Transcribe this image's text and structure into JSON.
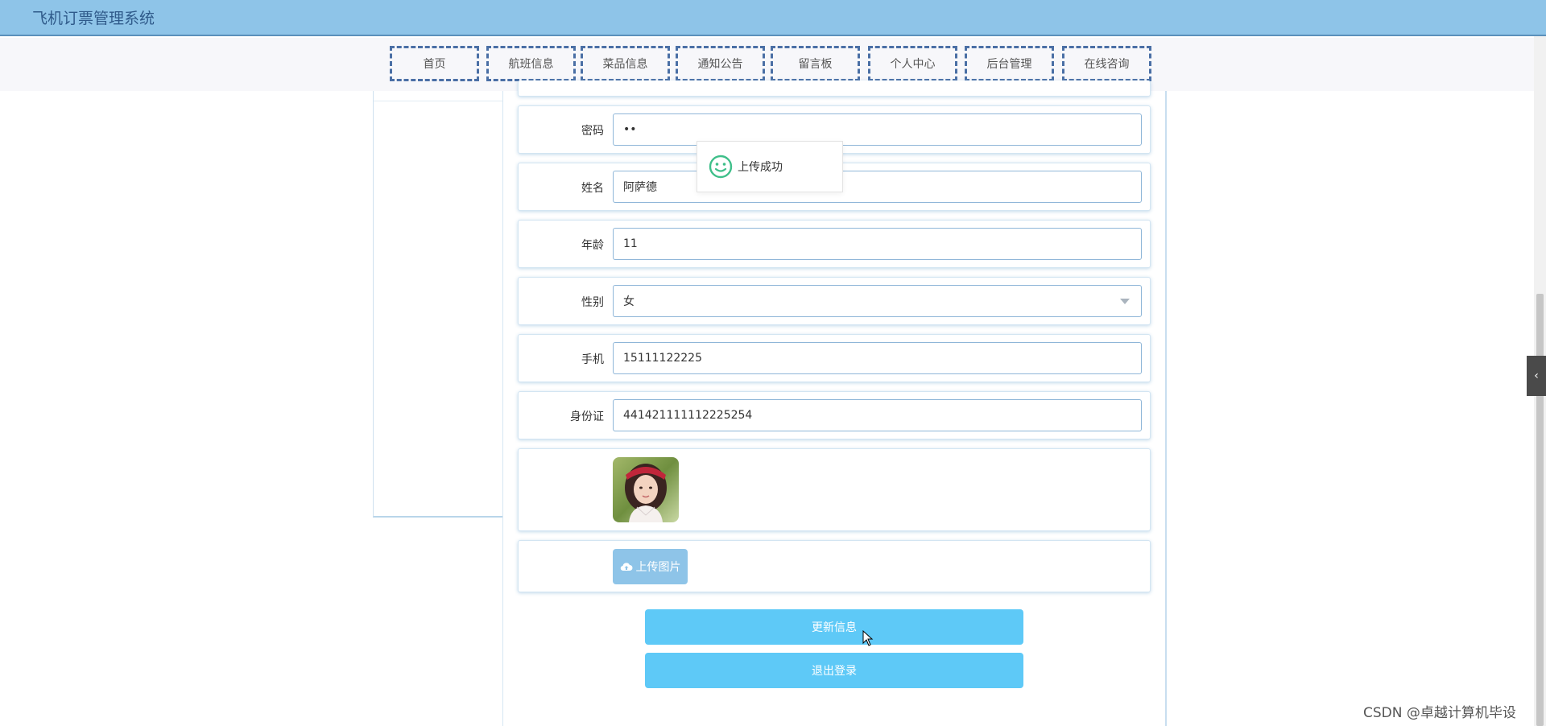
{
  "header": {
    "title": "飞机订票管理系统"
  },
  "nav": {
    "items": [
      {
        "label": "首页"
      },
      {
        "label": "航班信息"
      },
      {
        "label": "菜品信息"
      },
      {
        "label": "通知公告"
      },
      {
        "label": "留言板"
      },
      {
        "label": "个人中心"
      },
      {
        "label": "后台管理"
      },
      {
        "label": "在线咨询"
      }
    ]
  },
  "form": {
    "password": {
      "label": "密码",
      "value": "••"
    },
    "name": {
      "label": "姓名",
      "value": "阿萨德"
    },
    "age": {
      "label": "年龄",
      "value": "11"
    },
    "gender": {
      "label": "性别",
      "value": "女"
    },
    "phone": {
      "label": "手机",
      "value": "15111122225"
    },
    "idcard": {
      "label": "身份证",
      "value": "441421111112225254"
    },
    "upload_label": "上传图片",
    "update_label": "更新信息",
    "logout_label": "退出登录"
  },
  "toast": {
    "message": "上传成功"
  },
  "side_tab": {
    "glyph": "‹"
  },
  "watermark": "CSDN @卓越计算机毕设",
  "colors": {
    "header_bg": "#8ec4e8",
    "primary_button": "#5ec9f7",
    "nav_border": "#4a6fa5",
    "success_icon": "#3fbf8a"
  }
}
